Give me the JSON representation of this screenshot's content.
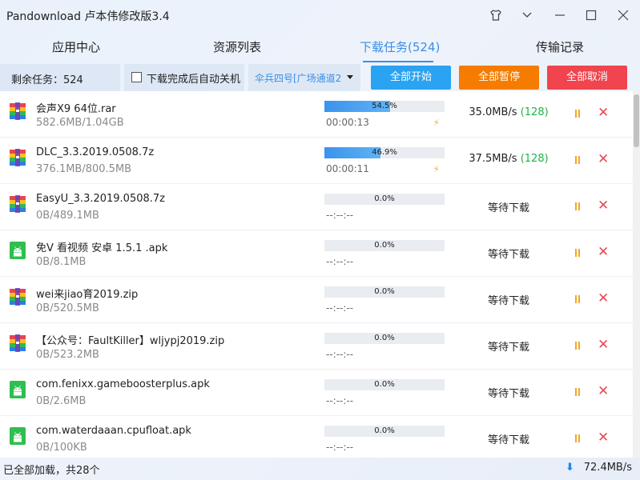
{
  "window": {
    "title": "Pandownload 卢本伟修改版3.4",
    "controls": [
      "skin-icon",
      "dropdown-icon",
      "minimize-icon",
      "maximize-icon",
      "close-icon"
    ]
  },
  "tabs": [
    {
      "label": "应用中心",
      "active": false
    },
    {
      "label": "资源列表",
      "active": false
    },
    {
      "label": "下载任务(524)",
      "active": true
    },
    {
      "label": "传输记录",
      "active": false
    }
  ],
  "toolbar": {
    "remaining": "剩余任务：524",
    "shutdown_label": "下载完成后自动关机",
    "shutdown_checked": false,
    "channel": "伞兵四号[广场通道2",
    "start_all": "全部开始",
    "pause_all": "全部暂停",
    "cancel_all": "全部取消",
    "colors": {
      "start": "#2aa3f2",
      "pause": "#f57c00",
      "cancel": "#f0444e"
    }
  },
  "tasks": [
    {
      "name": "会声X9 64位.rar",
      "size": "582.6MB/1.04GB",
      "progress": "54.5%",
      "progress_value": 54.5,
      "time": "00:00:13",
      "boost": true,
      "speed": "35.0MB/s",
      "connections": "(128)",
      "status": "",
      "icon": "archive-icon"
    },
    {
      "name": "DLC_3.3.2019.0508.7z",
      "size": "376.1MB/800.5MB",
      "progress": "46.9%",
      "progress_value": 46.9,
      "time": "00:00:11",
      "boost": true,
      "speed": "37.5MB/s",
      "connections": "(128)",
      "status": "",
      "icon": "archive-icon"
    },
    {
      "name": "EasyU_3.3.2019.0508.7z",
      "size": "0B/489.1MB",
      "progress": "0.0%",
      "progress_value": 0,
      "time": "--:--:--",
      "boost": false,
      "speed": "",
      "connections": "",
      "status": "等待下载",
      "icon": "archive-icon"
    },
    {
      "name": "免V 看视频 安卓 1.5.1 .apk",
      "size": "0B/8.1MB",
      "progress": "0.0%",
      "progress_value": 0,
      "time": "--:--:--",
      "boost": false,
      "speed": "",
      "connections": "",
      "status": "等待下载",
      "icon": "android-icon"
    },
    {
      "name": "wei来jiao育2019.zip",
      "size": "0B/520.5MB",
      "progress": "0.0%",
      "progress_value": 0,
      "time": "--:--:--",
      "boost": false,
      "speed": "",
      "connections": "",
      "status": "等待下载",
      "icon": "archive-icon"
    },
    {
      "name": "【公众号：FaultKiller】wljypj2019.zip",
      "size": "0B/523.2MB",
      "progress": "0.0%",
      "progress_value": 0,
      "time": "--:--:--",
      "boost": false,
      "speed": "",
      "connections": "",
      "status": "等待下载",
      "icon": "archive-icon"
    },
    {
      "name": "com.fenixx.gameboosterplus.apk",
      "size": "0B/2.6MB",
      "progress": "0.0%",
      "progress_value": 0,
      "time": "--:--:--",
      "boost": false,
      "speed": "",
      "connections": "",
      "status": "等待下载",
      "icon": "android-icon"
    },
    {
      "name": "com.waterdaaan.cpufloat.apk",
      "size": "0B/100KB",
      "progress": "0.0%",
      "progress_value": 0,
      "time": "--:--:--",
      "boost": false,
      "speed": "",
      "connections": "",
      "status": "等待下载",
      "icon": "android-icon"
    }
  ],
  "status_bar": {
    "left": "已全部加载，共28个",
    "speed": "72.4MB/s"
  }
}
